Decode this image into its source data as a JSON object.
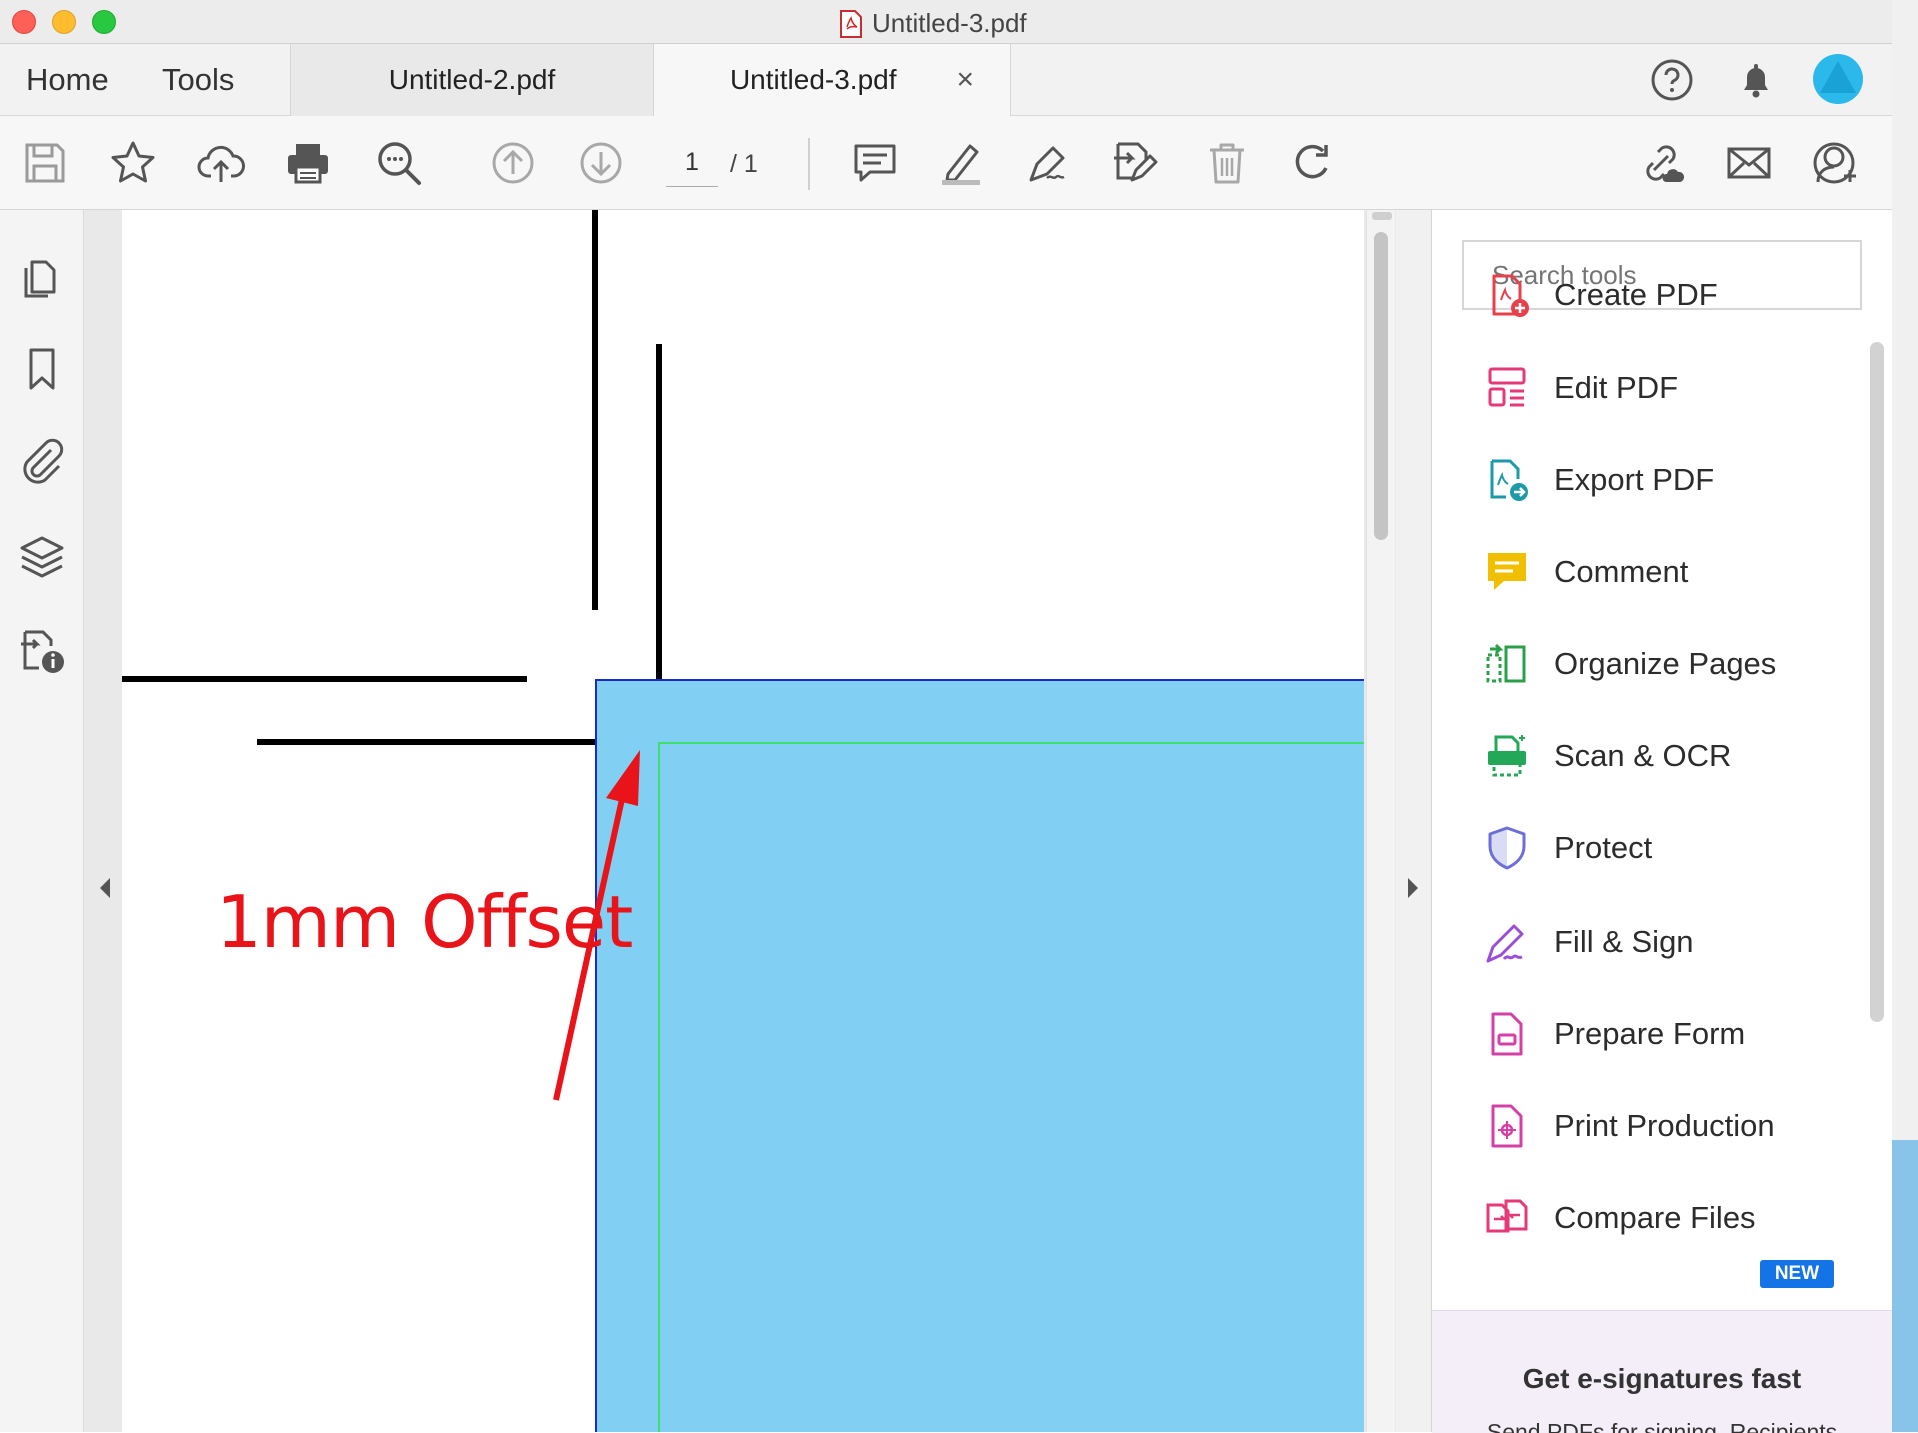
{
  "window": {
    "title": "Untitled-3.pdf"
  },
  "nav": {
    "home": "Home",
    "tools": "Tools"
  },
  "tabs": [
    {
      "label": "Untitled-2.pdf"
    },
    {
      "label": "Untitled-3.pdf",
      "close": "×"
    }
  ],
  "toolbar": {
    "page_current": "1",
    "page_total": "/ 1"
  },
  "document": {
    "annotation": "1mm Offset",
    "fill_color": "#82cff4",
    "annotation_color": "#e8141a"
  },
  "tools_panel": {
    "search_placeholder": "Search tools",
    "items": [
      {
        "label": "Create PDF",
        "icon": "create-pdf-icon",
        "color": "#e8404a"
      },
      {
        "label": "Edit PDF",
        "icon": "edit-pdf-icon",
        "color": "#e6397a"
      },
      {
        "label": "Export PDF",
        "icon": "export-pdf-icon",
        "color": "#1d9aa8"
      },
      {
        "label": "Comment",
        "icon": "comment-icon",
        "color": "#f0c000"
      },
      {
        "label": "Organize Pages",
        "icon": "organize-pages-icon",
        "color": "#2aa04a"
      },
      {
        "label": "Scan & OCR",
        "icon": "scan-ocr-icon",
        "color": "#22a858"
      },
      {
        "label": "Protect",
        "icon": "protect-icon",
        "color": "#6b6fd6"
      },
      {
        "label": "Fill & Sign",
        "icon": "fill-sign-icon",
        "color": "#9a4fd6"
      },
      {
        "label": "Prepare Form",
        "icon": "prepare-form-icon",
        "color": "#d63fa6"
      },
      {
        "label": "Print Production",
        "icon": "print-production-icon",
        "color": "#d63fa6"
      },
      {
        "label": "Compare Files",
        "icon": "compare-files-icon",
        "color": "#e6397a",
        "badge": "NEW"
      }
    ],
    "promo": {
      "title": "Get e-signatures fast",
      "text": "Send PDFs for signing. Recipients"
    }
  }
}
